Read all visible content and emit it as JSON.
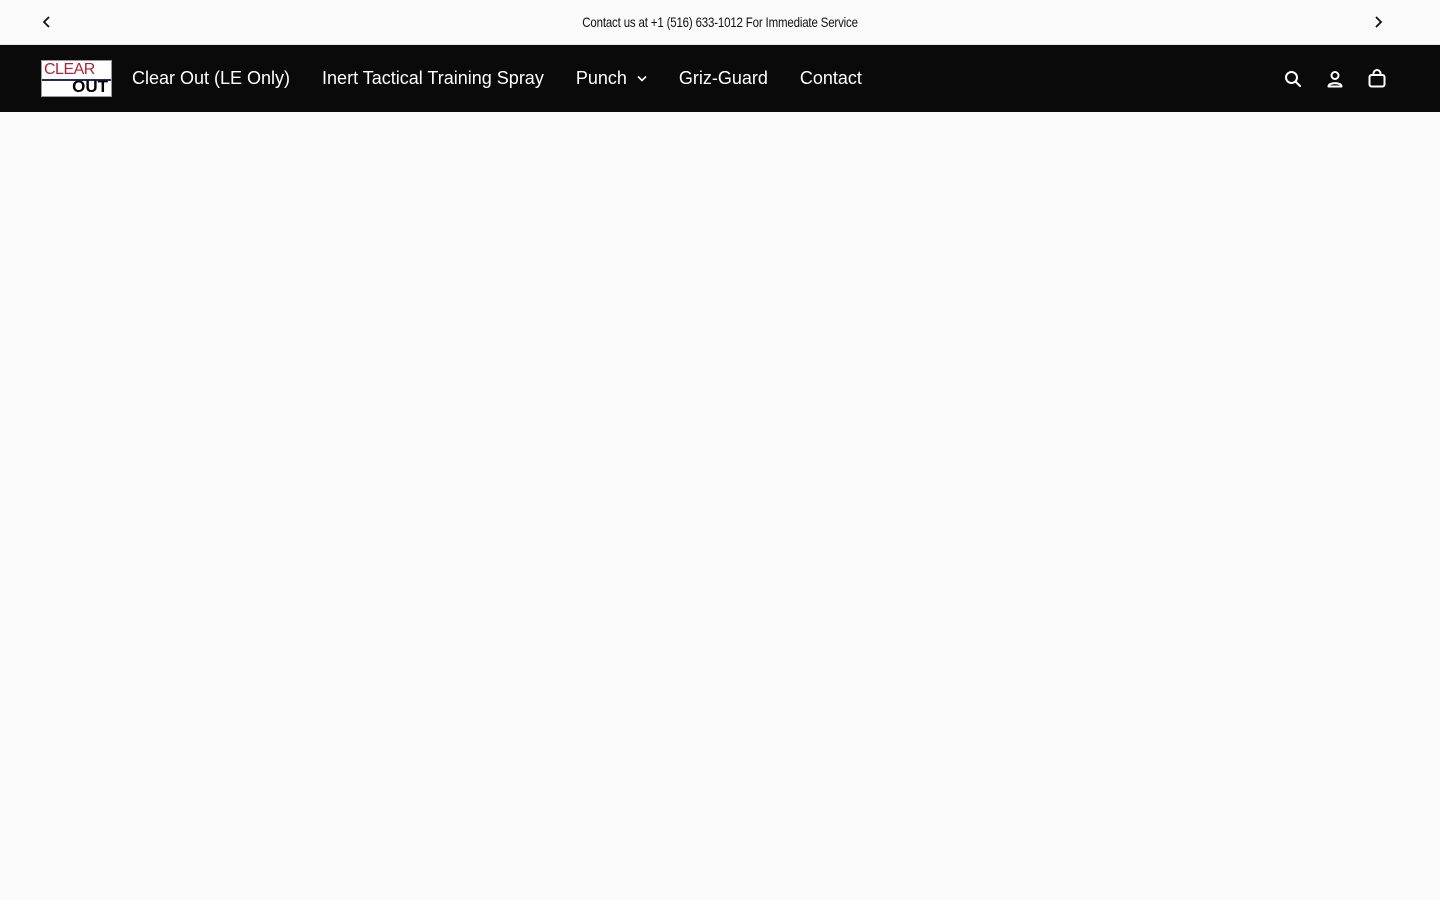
{
  "announcement": {
    "text": "Contact us at +1 (516) 633-1012 For Immediate Service",
    "prev_icon": "chevron-left-icon",
    "next_icon": "chevron-right-icon"
  },
  "header": {
    "logo": {
      "line1": "CLEAR",
      "line2": "OUT"
    },
    "nav": [
      {
        "label": "Clear Out (LE Only)"
      },
      {
        "label": "Inert Tactical Training Spray"
      },
      {
        "label": "Punch",
        "has_dropdown": true
      },
      {
        "label": "Griz-Guard"
      },
      {
        "label": "Contact"
      }
    ],
    "icons": [
      "search-icon",
      "account-icon",
      "cart-icon"
    ]
  },
  "colors": {
    "header_bg": "#0a0a0a",
    "page_bg": "#fafafa",
    "logo_red": "#b0223a"
  }
}
